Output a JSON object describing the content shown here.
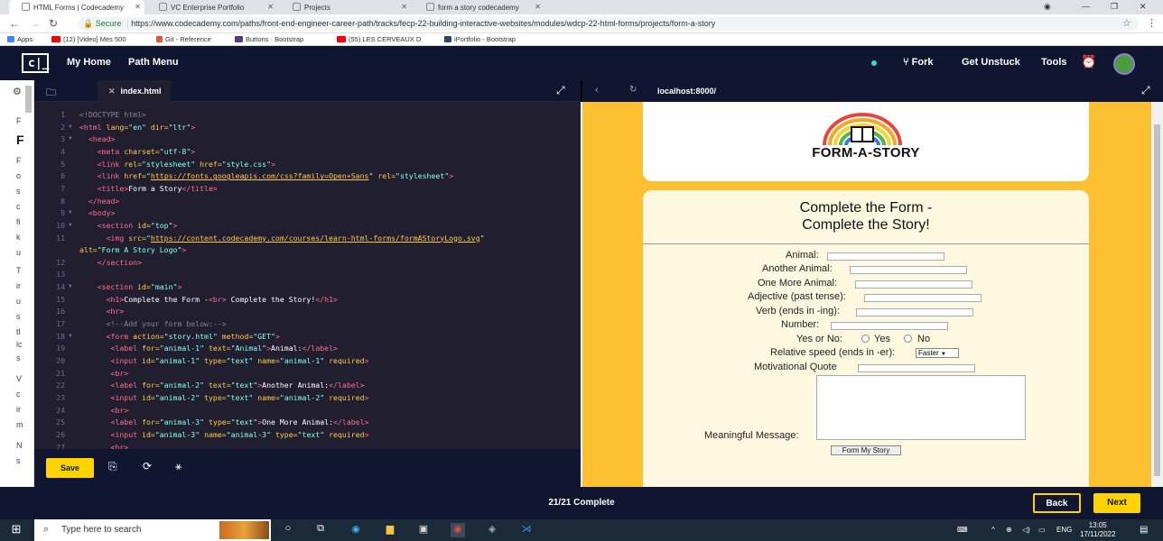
{
  "tabs": [
    {
      "label": "HTML Forms | Codecademy",
      "active": true
    },
    {
      "label": "VC Enterprise Portfolio",
      "active": false
    },
    {
      "label": "Projects",
      "active": false
    },
    {
      "label": "form a story codecademy",
      "active": false
    }
  ],
  "address": {
    "secure_label": "Secure",
    "url": "https://www.codecademy.com/paths/front-end-engineer-career-path/tracks/fecp-22-building-interactive-websites/modules/wdcp-22-html-forms/projects/form-a-story"
  },
  "bookmarks": [
    {
      "label": "Apps",
      "color": "#4285f4"
    },
    {
      "label": "(12) [Video] Mes 500",
      "color": "#ff0000"
    },
    {
      "label": "Git - Reference",
      "color": "#f05133"
    },
    {
      "label": "Buttons · Bootstrap",
      "color": "#563d7c"
    },
    {
      "label": "(55) LES CERVEAUX D",
      "color": "#ff0000"
    },
    {
      "label": "iPortfolio - Bootstrap",
      "color": "#2c4964"
    }
  ],
  "topnav": {
    "logo": "c|_",
    "my_home": "My Home",
    "path_menu": "Path Menu",
    "fork": "Fork",
    "get_unstuck": "Get Unstuck",
    "tools": "Tools"
  },
  "left_panel_letters": [
    "F",
    "F",
    "F",
    "o",
    "s",
    "c",
    "fi",
    "k",
    "u",
    "T",
    "ir",
    "u",
    "s",
    "tl",
    "lc",
    "s",
    "V",
    "c",
    "ir",
    "m",
    "N",
    "s"
  ],
  "editor": {
    "filename": "index.html",
    "save_label": "Save"
  },
  "code_lines": [
    {
      "n": "1",
      "fold": "",
      "html": "<span class='c'>&lt;!DOCTYPE html&gt;</span>"
    },
    {
      "n": "2",
      "fold": "▼",
      "html": "<span class='t'>&lt;html</span> <span class='a'>lang=</span><span class='s'>\"en\"</span> <span class='a'>dir=</span><span class='s'>\"ltr\"</span><span class='t'>&gt;</span>"
    },
    {
      "n": "3",
      "fold": "▼",
      "html": "  <span class='t'>&lt;head&gt;</span>"
    },
    {
      "n": "4",
      "fold": "",
      "html": "    <span class='t'>&lt;meta</span> <span class='a'>charset=</span><span class='s'>\"utf-8\"</span><span class='t'>&gt;</span>"
    },
    {
      "n": "5",
      "fold": "",
      "html": "    <span class='t'>&lt;link</span> <span class='a'>rel=</span><span class='s'>\"stylesheet\"</span> <span class='a'>href=</span><span class='s'>\"style.css\"</span><span class='t'>&gt;</span>"
    },
    {
      "n": "6",
      "fold": "",
      "html": "    <span class='t'>&lt;link</span> <span class='a'>href=</span><span class='s'>\"<span class='u'>https://fonts.googleapis.com/css?family=Open+Sans</span>\"</span> <span class='a'>rel=</span><span class='s'>\"stylesheet\"</span><span class='t'>&gt;</span>"
    },
    {
      "n": "7",
      "fold": "",
      "html": "    <span class='t'>&lt;title&gt;</span>Form a Story<span class='t'>&lt;/title&gt;</span>"
    },
    {
      "n": "8",
      "fold": "",
      "html": "  <span class='t'>&lt;/head&gt;</span>"
    },
    {
      "n": "9",
      "fold": "▼",
      "html": "  <span class='t'>&lt;body&gt;</span>"
    },
    {
      "n": "10",
      "fold": "▼",
      "html": "    <span class='t'>&lt;section</span> <span class='a'>id=</span><span class='s'>\"top\"</span><span class='t'>&gt;</span>"
    },
    {
      "n": "11",
      "fold": "",
      "html": "      <span class='t'>&lt;img</span> <span class='a'>src=</span><span class='s'>\"<span class='u'>https://content.codecademy.com/courses/learn-html-forms/formAStoryLogo.svg</span>\"</span>"
    },
    {
      "n": "",
      "fold": "",
      "html": "<span class='a'>alt=</span><span class='s'>\"Form A Story Logo\"</span><span class='t'>&gt;</span>",
      "wrap": true
    },
    {
      "n": "12",
      "fold": "",
      "html": "    <span class='t'>&lt;/section&gt;</span>"
    },
    {
      "n": "13",
      "fold": "",
      "html": ""
    },
    {
      "n": "14",
      "fold": "▼",
      "html": "    <span class='t'>&lt;section</span> <span class='a'>id=</span><span class='s'>\"main\"</span><span class='t'>&gt;</span>"
    },
    {
      "n": "15",
      "fold": "",
      "html": "      <span class='t'>&lt;h1&gt;</span>Complete the Form -<span class='t'>&lt;br&gt;</span> Complete the Story!<span class='t'>&lt;/h1&gt;</span>"
    },
    {
      "n": "16",
      "fold": "",
      "html": "      <span class='t'>&lt;hr&gt;</span>"
    },
    {
      "n": "17",
      "fold": "",
      "html": "      <span class='c'>&lt;!--Add your form below:--&gt;</span>"
    },
    {
      "n": "18",
      "fold": "▼",
      "html": "      <span class='t'>&lt;form</span> <span class='a'>action=</span><span class='s'>\"story.html\"</span> <span class='a'>method=</span><span class='s'>\"GET\"</span><span class='t'>&gt;</span>"
    },
    {
      "n": "19",
      "fold": "",
      "html": "       <span class='t'>&lt;label</span> <span class='a'>for=</span><span class='s'>\"animal-1\"</span> <span class='a'>text=</span><span class='s'>\"Animal\"</span><span class='t'>&gt;</span>Animal:<span class='t'>&lt;/label&gt;</span>"
    },
    {
      "n": "20",
      "fold": "",
      "html": "       <span class='t'>&lt;input</span> <span class='a'>id=</span><span class='s'>\"animal-1\"</span> <span class='a'>type=</span><span class='s'>\"text\"</span> <span class='a'>name=</span><span class='s'>\"animal-1\"</span> <span class='a'>required</span><span class='t'>&gt;</span>"
    },
    {
      "n": "21",
      "fold": "",
      "html": "       <span class='t'>&lt;br&gt;</span>"
    },
    {
      "n": "22",
      "fold": "",
      "html": "       <span class='t'>&lt;label</span> <span class='a'>for=</span><span class='s'>\"animal-2\"</span> <span class='a'>text=</span><span class='s'>\"text\"</span><span class='t'>&gt;</span>Another Animal:<span class='t'>&lt;/label&gt;</span>"
    },
    {
      "n": "23",
      "fold": "",
      "html": "       <span class='t'>&lt;input</span> <span class='a'>id=</span><span class='s'>\"animal-2\"</span> <span class='a'>type=</span><span class='s'>\"text\"</span> <span class='a'>name=</span><span class='s'>\"animal-2\"</span> <span class='a'>required</span><span class='t'>&gt;</span>"
    },
    {
      "n": "24",
      "fold": "",
      "html": "       <span class='t'>&lt;br&gt;</span>"
    },
    {
      "n": "25",
      "fold": "",
      "html": "       <span class='t'>&lt;label</span> <span class='a'>for=</span><span class='s'>\"animal-3\"</span> <span class='a'>type=</span><span class='s'>\"text\"</span><span class='t'>&gt;</span>One More Animal:<span class='t'>&lt;/label&gt;</span>"
    },
    {
      "n": "26",
      "fold": "",
      "html": "       <span class='t'>&lt;input</span> <span class='a'>id=</span><span class='s'>\"animal-3\"</span> <span class='a'>name=</span><span class='s'>\"animal-3\"</span> <span class='a'>type=</span><span class='s'>\"text\"</span> <span class='a'>required</span><span class='t'>&gt;</span>"
    },
    {
      "n": "27",
      "fold": "",
      "html": "       <span class='t'>&lt;br&gt;</span>"
    }
  ],
  "browser": {
    "url": "localhost:8000/"
  },
  "preview": {
    "logo_text": "FORM-A-STORY",
    "heading_line1": "Complete the Form -",
    "heading_line2": "Complete the Story!",
    "fields": [
      {
        "label": "Animal:",
        "type": "text"
      },
      {
        "label": "Another Animal:",
        "type": "text"
      },
      {
        "label": "One More Animal:",
        "type": "text"
      },
      {
        "label": "Adjective (past tense):",
        "type": "text"
      },
      {
        "label": "Verb (ends in -ing):",
        "type": "text"
      },
      {
        "label": "Number:",
        "type": "text"
      }
    ],
    "yes_no_label": "Yes or No:",
    "yes": "Yes",
    "no": "No",
    "speed_label": "Relative speed (ends in -er):",
    "speed_value": "Faster",
    "quote_label": "Motivational Quote",
    "message_label": "Meaningful Message:",
    "submit_label": "Form My Story"
  },
  "bottom": {
    "progress": "21/21 Complete",
    "back": "Back",
    "next": "Next"
  },
  "taskbar": {
    "search_placeholder": "Type here to search",
    "language": "ENG",
    "time": "13:05",
    "date": "17/11/2022"
  },
  "colors": {
    "nav_bg": "#10162f",
    "editor_bg": "#211e2f",
    "accent_yellow": "#ffd300",
    "preview_bg": "#fcc030"
  }
}
